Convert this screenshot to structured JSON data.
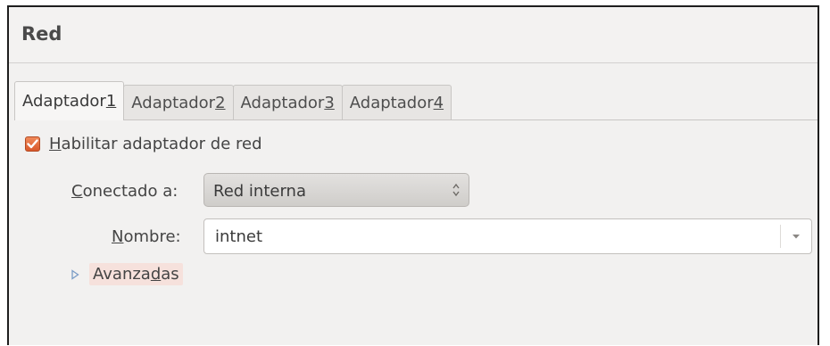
{
  "window": {
    "title": "Red"
  },
  "tabs": [
    {
      "pre": "Adaptador ",
      "mnemonic": "1",
      "post": "",
      "active": true
    },
    {
      "pre": "Adaptador ",
      "mnemonic": "2",
      "post": "",
      "active": false
    },
    {
      "pre": "Adaptador ",
      "mnemonic": "3",
      "post": "",
      "active": false
    },
    {
      "pre": "Adaptador ",
      "mnemonic": "4",
      "post": "",
      "active": false
    }
  ],
  "enable_adapter": {
    "checked": true,
    "mnemonic": "H",
    "rest": "abilitar adaptador de red"
  },
  "connected_to": {
    "mnemonic": "C",
    "rest": "onectado a:",
    "value": "Red interna"
  },
  "name_field": {
    "mnemonic": "N",
    "rest": "ombre:",
    "value": "intnet"
  },
  "advanced": {
    "pre": "Avanza",
    "mnemonic": "d",
    "post": "as"
  },
  "colors": {
    "checkbox_accent": "#e0693a",
    "highlight": "#f6e1dc",
    "icon_blue": "#7a9cc6"
  },
  "icons": {
    "checkbox": "checkmark-icon",
    "select": "spin-arrows-icon",
    "combo": "dropdown-arrow-icon",
    "expander": "expander-triangle-icon"
  }
}
